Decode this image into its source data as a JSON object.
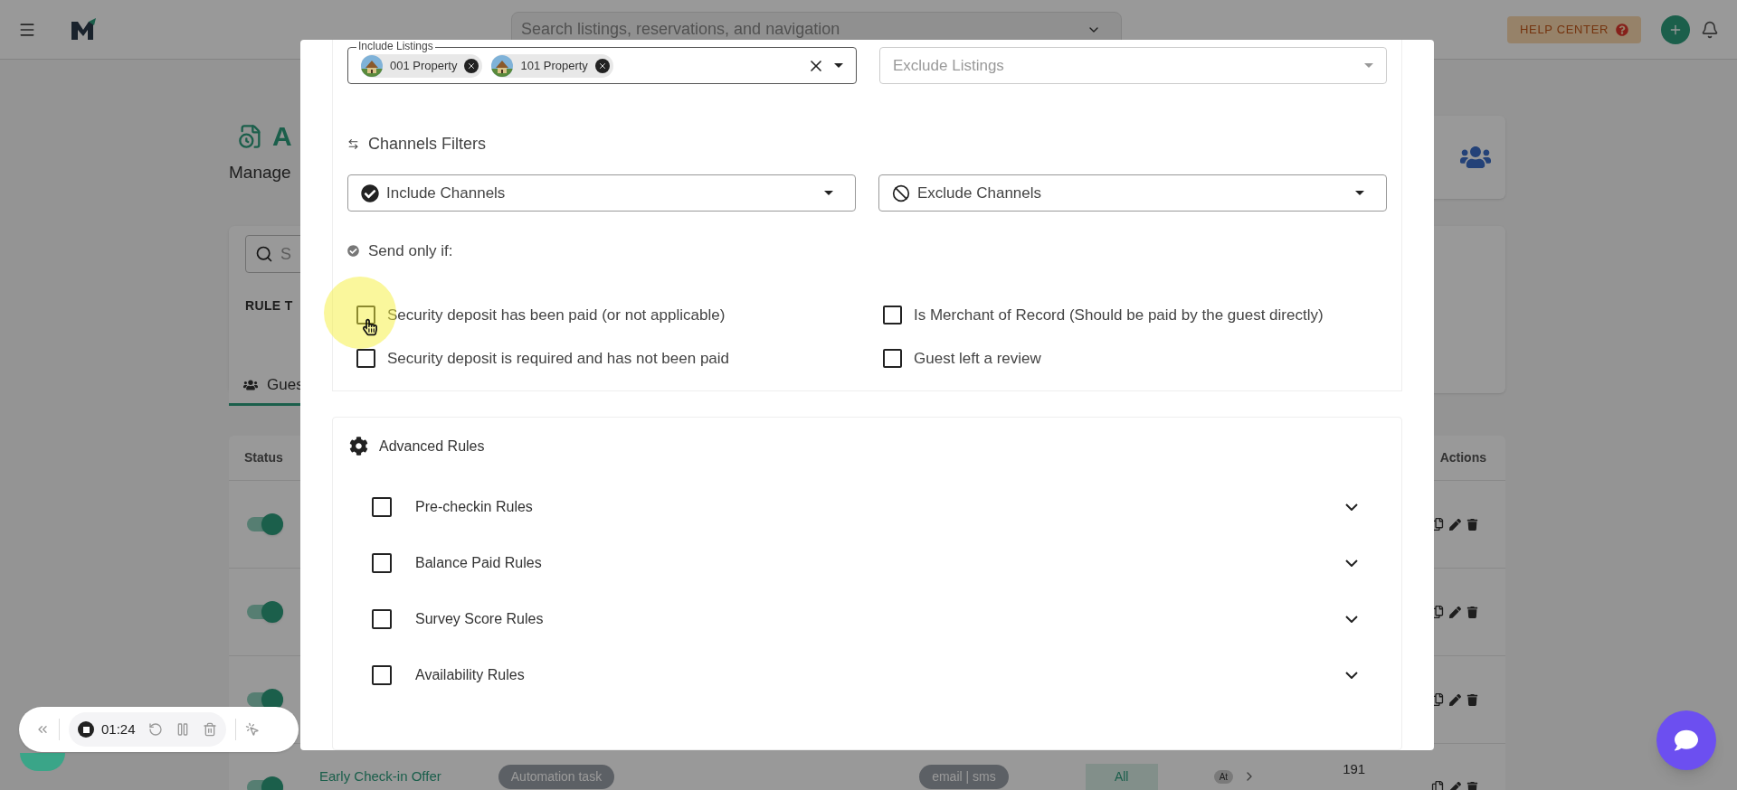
{
  "top_bar": {
    "search_placeholder": "Search listings, reservations, and navigation",
    "help_center": "HELP CENTER"
  },
  "page": {
    "title": "A",
    "subtitle": "Manage",
    "search_placeholder": "S",
    "section_label": "RULE T",
    "tabs": [
      {
        "label": "Gues",
        "selected": true
      }
    ],
    "table": {
      "columns": [
        "Status",
        "Actions"
      ],
      "rows": [
        {
          "on": true
        },
        {
          "on": true
        },
        {
          "on": true
        },
        {
          "on": true,
          "name": "Early Check-in Offer",
          "type": "Automation task",
          "channels": "email | sms",
          "scope": "All",
          "timing": "At",
          "total": "191"
        }
      ]
    }
  },
  "modal": {
    "include_listings": {
      "label": "Include Listings",
      "chips": [
        {
          "label": "001 Property"
        },
        {
          "label": "101 Property"
        }
      ]
    },
    "exclude_listings": {
      "placeholder": "Exclude Listings"
    },
    "channels_filters": {
      "title": "Channels Filters",
      "include": "Include Channels",
      "exclude": "Exclude Channels"
    },
    "send_only_if": {
      "title": "Send only if:",
      "conditions": [
        {
          "label": "Security deposit has been paid (or not applicable)",
          "checked": false
        },
        {
          "label": "Is Merchant of Record (Should be paid by the guest directly)",
          "checked": false
        },
        {
          "label": "Security deposit is required and has not been paid",
          "checked": false
        },
        {
          "label": "Guest left a review",
          "checked": false
        }
      ]
    },
    "advanced_rules": {
      "title": "Advanced Rules",
      "rules": [
        {
          "label": "Pre-checkin Rules",
          "checked": false,
          "expanded": false
        },
        {
          "label": "Balance Paid Rules",
          "checked": false,
          "expanded": false
        },
        {
          "label": "Survey Score Rules",
          "checked": false,
          "expanded": false
        },
        {
          "label": "Availability Rules",
          "checked": false,
          "expanded": false
        }
      ]
    }
  },
  "recorder": {
    "time": "01:24"
  }
}
